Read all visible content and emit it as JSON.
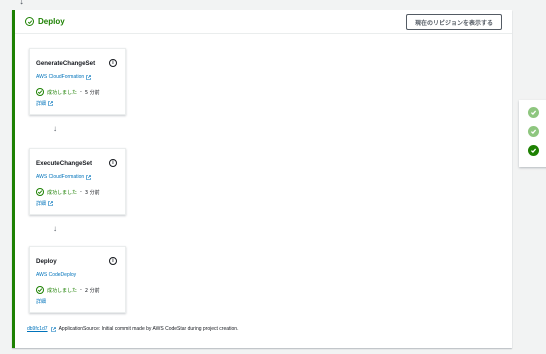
{
  "stage": {
    "title": "Deploy",
    "revision_button": "現在のリビジョンを表示する"
  },
  "actions": [
    {
      "name": "GenerateChangeSet",
      "provider": "AWS CloudFormation",
      "status": "成功しました",
      "time": "5 分前",
      "details": "詳細"
    },
    {
      "name": "ExecuteChangeSet",
      "provider": "AWS CloudFormation",
      "status": "成功しました",
      "time": "3 分前",
      "details": "詳細"
    },
    {
      "name": "Deploy",
      "provider": "AWS CodeDeploy",
      "status": "成功しました",
      "time": "2 分前",
      "details": "詳細"
    }
  ],
  "commit": {
    "hash": "db9fc1d7",
    "message": "ApplicationSource: Initial commit made by AWS CodeStar during project creation."
  },
  "colors": {
    "success": "#1d8102",
    "link": "#0073bb",
    "success_light": "#8ec67f"
  },
  "side_indicators": [
    "check-light",
    "check-light",
    "check-dark"
  ]
}
